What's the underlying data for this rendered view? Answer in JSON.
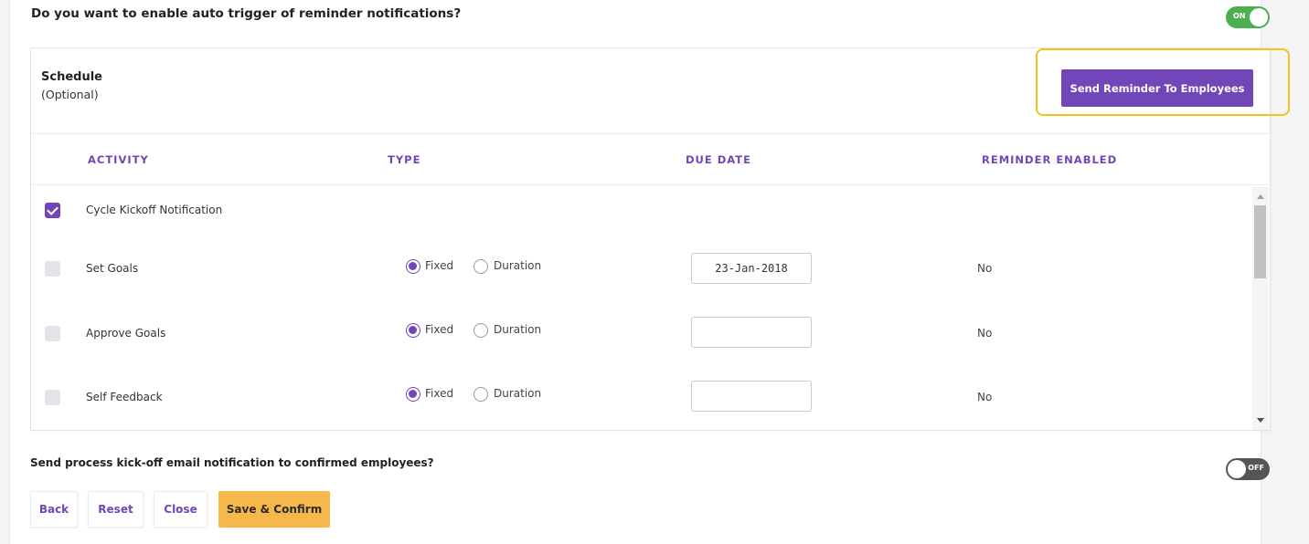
{
  "auto_trigger": {
    "question": "Do you want to enable auto trigger of reminder notifications?",
    "toggle_label": "ON"
  },
  "schedule": {
    "title": "Schedule",
    "subtitle": "(Optional)",
    "send_button": "Send Reminder To Employees"
  },
  "table": {
    "headers": {
      "activity": "ACTIVITY",
      "type": "TYPE",
      "due_date": "DUE DATE",
      "reminder": "REMINDER ENABLED"
    },
    "rows": [
      {
        "activity": "Cycle Kickoff Notification",
        "checked": true
      },
      {
        "activity": "Set Goals",
        "checked": false,
        "fixed": "Fixed",
        "duration": "Duration",
        "due_date": "23-Jan-2018",
        "reminder": "No"
      },
      {
        "activity": "Approve Goals",
        "checked": false,
        "fixed": "Fixed",
        "duration": "Duration",
        "due_date": "",
        "reminder": "No"
      },
      {
        "activity": "Self Feedback",
        "checked": false,
        "fixed": "Fixed",
        "duration": "Duration",
        "due_date": "",
        "reminder": "No"
      }
    ]
  },
  "kickoff": {
    "question": "Send process kick-off email notification to confirmed employees?",
    "toggle_label": "OFF"
  },
  "footer": {
    "back": "Back",
    "reset": "Reset",
    "close": "Close",
    "save": "Save & Confirm"
  },
  "colors": {
    "accent": "#7046b8",
    "toggle_on": "#4caf50",
    "toggle_off": "#555555",
    "highlight": "#f0c419",
    "save_button": "#f7b84b"
  }
}
